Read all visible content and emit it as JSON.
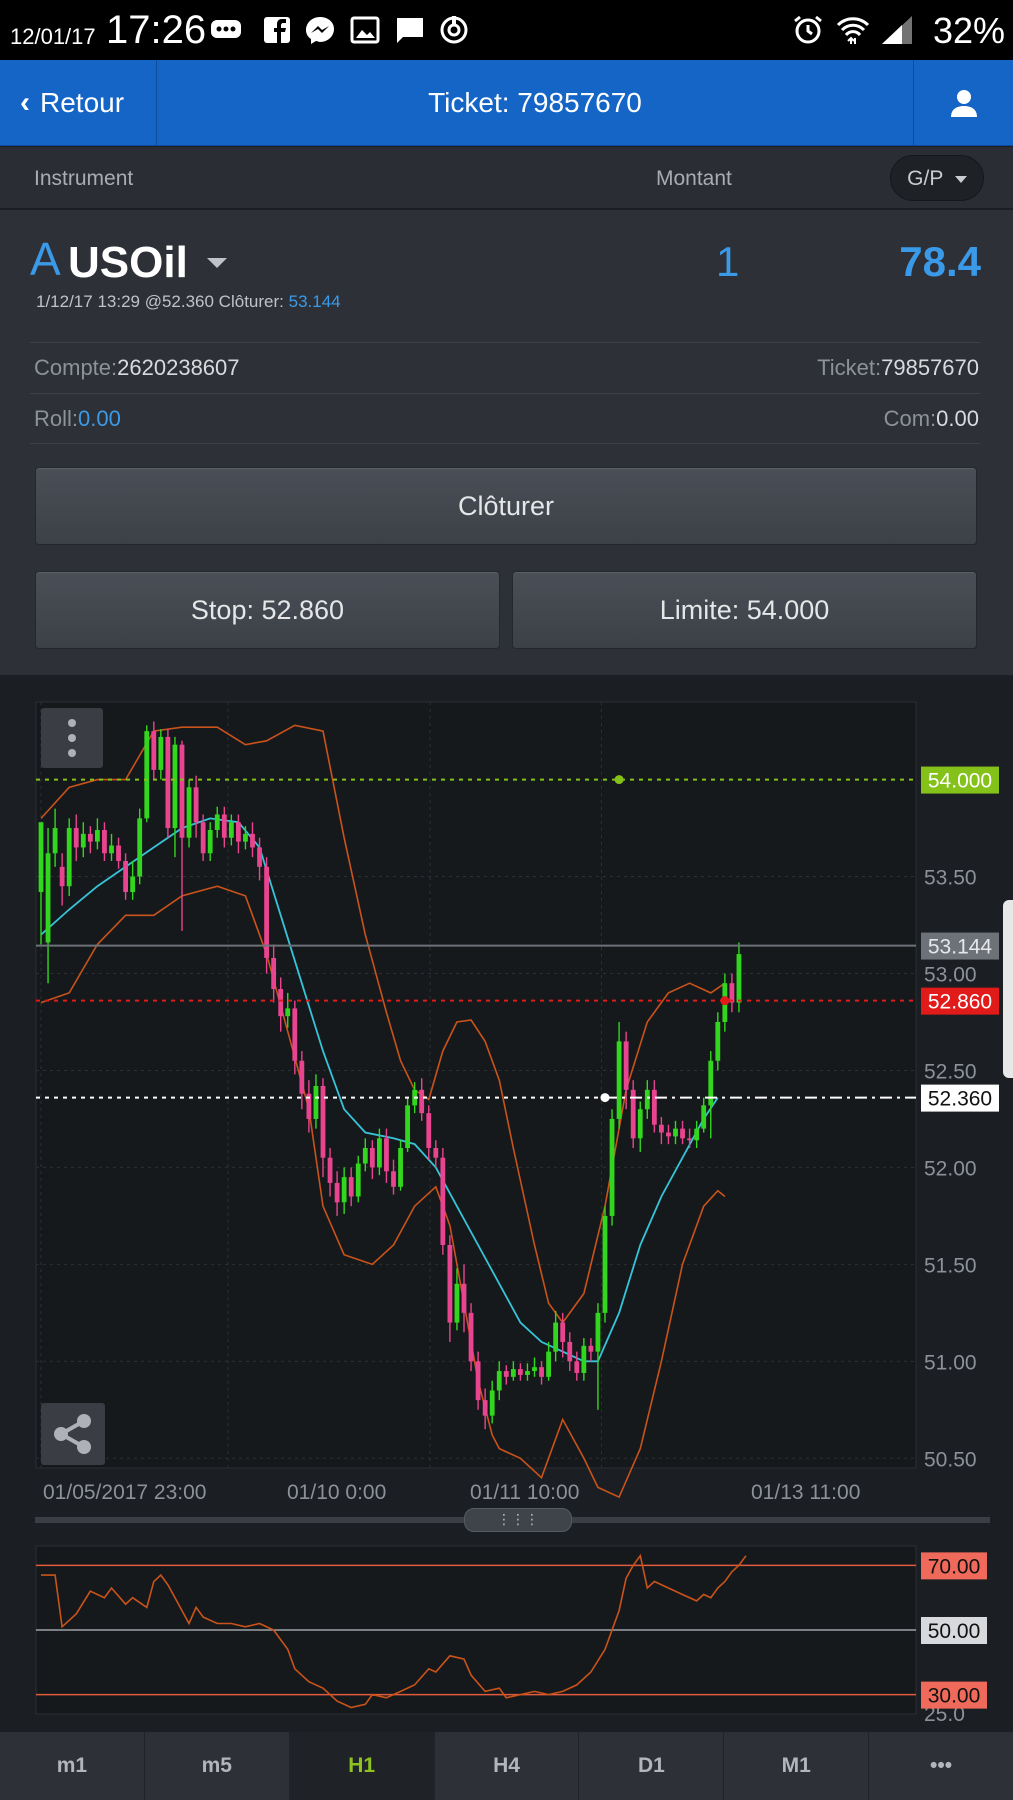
{
  "status_bar": {
    "date": "12/01/17",
    "time": "17:26",
    "battery": "32%",
    "icons": [
      "chat-bubble-icon",
      "facebook-icon",
      "messenger-icon",
      "gallery-icon",
      "message-icon",
      "sync-icon",
      "alarm-icon",
      "wifi-icon",
      "signal-icon"
    ]
  },
  "nav": {
    "back_label": "Retour",
    "title": "Ticket: 79857670"
  },
  "columns": {
    "instrument": "Instrument",
    "amount": "Montant",
    "gp_label": "G/P"
  },
  "position": {
    "prefix": "A",
    "symbol": "USOil",
    "quantity": "1",
    "pl": "78.4",
    "open_info": "1/12/17 13:29 @52.360 Clôturer:",
    "close_price": "53.144",
    "account_label": "Compte:",
    "account_value": "2620238607",
    "ticket_label": "Ticket:",
    "ticket_value": "79857670",
    "roll_label": "Roll:",
    "roll_value": "0.00",
    "com_label": "Com:",
    "com_value": "0.00"
  },
  "buttons": {
    "close": "Clôturer",
    "stop": "Stop: 52.860",
    "limit": "Limite: 54.000"
  },
  "timeframes": [
    "m1",
    "m5",
    "H1",
    "H4",
    "D1",
    "M1",
    "•••"
  ],
  "active_timeframe": "H1",
  "colors": {
    "accent_blue": "#3b9ae8",
    "nav_blue": "#1565c7",
    "bull": "#33d61e",
    "bear": "#e8448f",
    "limit": "#84c21a",
    "stop": "#e11a1a",
    "bollinger": "#c9531a",
    "ma": "#36c4d8",
    "rsi": "#c9531a"
  },
  "chart_data": [
    {
      "type": "candlestick",
      "x_tick_labels": [
        "01/05/2017 23:00",
        "01/10 0:00",
        "01/11 10:00",
        "01/13 11:00"
      ],
      "y_tick_labels": [
        "53.50",
        "53.00",
        "52.50",
        "52.00",
        "51.50",
        "51.00",
        "50.50"
      ],
      "ylim": [
        50.45,
        54.4
      ],
      "levels": [
        {
          "label": "54.000",
          "value": 54.0
        },
        {
          "label": "53.144",
          "value": 53.144
        },
        {
          "label": "52.860",
          "value": 52.86
        },
        {
          "label": "52.360",
          "value": 52.36
        }
      ],
      "candles": [
        [
          53.42,
          53.78,
          53.65,
          53.15
        ],
        [
          53.16,
          53.62,
          53.75,
          52.95
        ],
        [
          53.62,
          53.75,
          53.85,
          53.55
        ],
        [
          53.55,
          53.45,
          53.62,
          53.35
        ],
        [
          53.45,
          53.75,
          53.8,
          53.4
        ],
        [
          53.75,
          53.65,
          53.82,
          53.58
        ],
        [
          53.65,
          53.72,
          53.78,
          53.6
        ],
        [
          53.72,
          53.68,
          53.76,
          53.62
        ],
        [
          53.68,
          53.74,
          53.8,
          53.64
        ],
        [
          53.74,
          53.62,
          53.78,
          53.58
        ],
        [
          53.62,
          53.66,
          53.72,
          53.58
        ],
        [
          53.66,
          53.58,
          53.7,
          53.54
        ],
        [
          53.58,
          53.42,
          53.62,
          53.38
        ],
        [
          53.42,
          53.5,
          53.58,
          53.38
        ],
        [
          53.5,
          53.8,
          53.85,
          53.46
        ],
        [
          53.8,
          54.25,
          54.28,
          53.78
        ],
        [
          54.25,
          54.05,
          54.3,
          54.0
        ],
        [
          54.05,
          54.22,
          54.26,
          54.0
        ],
        [
          54.22,
          53.75,
          54.26,
          53.7
        ],
        [
          53.75,
          54.18,
          54.22,
          53.6
        ],
        [
          54.18,
          53.7,
          54.2,
          53.22
        ],
        [
          53.7,
          53.96,
          54.0,
          53.65
        ],
        [
          53.96,
          53.78,
          54.02,
          53.7
        ],
        [
          53.78,
          53.62,
          53.82,
          53.58
        ],
        [
          53.62,
          53.74,
          53.78,
          53.58
        ],
        [
          53.74,
          53.82,
          53.86,
          53.7
        ],
        [
          53.82,
          53.7,
          53.86,
          53.65
        ],
        [
          53.7,
          53.78,
          53.82,
          53.66
        ],
        [
          53.78,
          53.68,
          53.82,
          53.62
        ],
        [
          53.68,
          53.72,
          53.76,
          53.64
        ],
        [
          53.72,
          53.65,
          53.78,
          53.6
        ],
        [
          53.65,
          53.55,
          53.7,
          53.48
        ],
        [
          53.55,
          53.08,
          53.6,
          53.0
        ],
        [
          53.08,
          52.92,
          53.15,
          52.85
        ],
        [
          52.92,
          52.78,
          52.98,
          52.7
        ],
        [
          52.78,
          52.82,
          52.9,
          52.72
        ],
        [
          52.82,
          52.55,
          52.86,
          52.48
        ],
        [
          52.55,
          52.38,
          52.6,
          52.3
        ],
        [
          52.38,
          52.25,
          52.45,
          52.18
        ],
        [
          52.25,
          52.42,
          52.48,
          52.2
        ],
        [
          52.42,
          52.05,
          52.46,
          51.95
        ],
        [
          52.05,
          51.92,
          52.1,
          51.85
        ],
        [
          51.92,
          51.82,
          51.98,
          51.75
        ],
        [
          51.82,
          51.95,
          52.0,
          51.76
        ],
        [
          51.95,
          51.85,
          52.0,
          51.8
        ],
        [
          51.85,
          52.02,
          52.06,
          51.82
        ],
        [
          52.02,
          52.1,
          52.15,
          51.98
        ],
        [
          52.1,
          52.0,
          52.14,
          51.94
        ],
        [
          52.0,
          52.15,
          52.2,
          51.96
        ],
        [
          52.15,
          51.98,
          52.2,
          51.92
        ],
        [
          51.98,
          51.9,
          52.04,
          51.86
        ],
        [
          51.9,
          52.1,
          52.14,
          51.88
        ],
        [
          52.1,
          52.32,
          52.36,
          52.08
        ],
        [
          52.32,
          52.4,
          52.44,
          52.28
        ],
        [
          52.4,
          52.28,
          52.46,
          52.24
        ],
        [
          52.28,
          52.1,
          52.32,
          52.04
        ],
        [
          52.1,
          52.05,
          52.14,
          52.0
        ],
        [
          52.05,
          51.6,
          52.1,
          51.55
        ],
        [
          51.6,
          51.2,
          51.65,
          51.1
        ],
        [
          51.2,
          51.4,
          51.48,
          51.16
        ],
        [
          51.4,
          51.25,
          51.5,
          51.15
        ],
        [
          51.25,
          51.0,
          51.3,
          50.95
        ],
        [
          51.0,
          50.8,
          51.05,
          50.75
        ],
        [
          50.8,
          50.72,
          50.86,
          50.65
        ],
        [
          50.72,
          50.85,
          50.9,
          50.68
        ],
        [
          50.85,
          50.95,
          51.0,
          50.8
        ],
        [
          50.95,
          50.92,
          50.98,
          50.88
        ],
        [
          50.92,
          50.96,
          51.0,
          50.9
        ],
        [
          50.96,
          50.93,
          50.99,
          50.9
        ],
        [
          50.93,
          50.95,
          50.99,
          50.9
        ],
        [
          50.95,
          50.97,
          51.02,
          50.92
        ],
        [
          50.97,
          50.92,
          51.0,
          50.88
        ],
        [
          50.92,
          51.05,
          51.1,
          50.9
        ],
        [
          51.05,
          51.2,
          51.26,
          51.0
        ],
        [
          51.2,
          51.1,
          51.25,
          51.02
        ],
        [
          51.1,
          51.0,
          51.15,
          50.95
        ],
        [
          51.0,
          50.94,
          51.05,
          50.9
        ],
        [
          50.94,
          51.08,
          51.12,
          50.9
        ],
        [
          51.08,
          51.05,
          51.12,
          51.0
        ],
        [
          51.05,
          51.25,
          51.3,
          50.75
        ],
        [
          51.25,
          51.75,
          51.8,
          51.2
        ],
        [
          51.75,
          52.25,
          52.3,
          51.7
        ],
        [
          52.25,
          52.65,
          52.75,
          52.2
        ],
        [
          52.65,
          52.4,
          52.7,
          52.3
        ],
        [
          52.4,
          52.15,
          52.45,
          52.1
        ],
        [
          52.15,
          52.3,
          52.34,
          52.08
        ],
        [
          52.3,
          52.4,
          52.45,
          52.25
        ],
        [
          52.4,
          52.22,
          52.45,
          52.18
        ],
        [
          52.22,
          52.18,
          52.26,
          52.12
        ],
        [
          52.18,
          52.16,
          52.22,
          52.12
        ],
        [
          52.16,
          52.2,
          52.24,
          52.12
        ],
        [
          52.2,
          52.15,
          52.24,
          52.12
        ],
        [
          52.15,
          52.14,
          52.2,
          52.1
        ],
        [
          52.14,
          52.2,
          52.24,
          52.1
        ],
        [
          52.2,
          52.32,
          52.36,
          52.18
        ],
        [
          52.32,
          52.55,
          52.6,
          52.15
        ],
        [
          52.55,
          52.75,
          52.8,
          52.5
        ],
        [
          52.75,
          52.95,
          53.0,
          52.7
        ],
        [
          52.95,
          52.85,
          53.0,
          52.8
        ],
        [
          52.85,
          53.1,
          53.16,
          52.8
        ]
      ],
      "moving_average": [
        [
          0,
          53.2
        ],
        [
          4,
          53.33
        ],
        [
          8,
          53.45
        ],
        [
          12,
          53.55
        ],
        [
          16,
          53.65
        ],
        [
          20,
          53.75
        ],
        [
          24,
          53.8
        ],
        [
          28,
          53.78
        ],
        [
          31,
          53.65
        ],
        [
          34,
          53.3
        ],
        [
          37,
          52.95
        ],
        [
          40,
          52.6
        ],
        [
          43,
          52.3
        ],
        [
          46,
          52.18
        ],
        [
          50,
          52.15
        ],
        [
          53,
          52.12
        ],
        [
          56,
          52.0
        ],
        [
          59,
          51.8
        ],
        [
          62,
          51.6
        ],
        [
          65,
          51.4
        ],
        [
          68,
          51.2
        ],
        [
          71,
          51.1
        ],
        [
          74,
          51.05
        ],
        [
          77,
          51.0
        ],
        [
          79,
          51.0
        ],
        [
          82,
          51.25
        ],
        [
          85,
          51.6
        ],
        [
          88,
          51.85
        ],
        [
          91,
          52.05
        ],
        [
          94,
          52.25
        ],
        [
          96,
          52.36
        ]
      ],
      "bollinger_upper": [
        [
          0,
          53.8
        ],
        [
          4,
          53.96
        ],
        [
          8,
          54.0
        ],
        [
          12,
          54.0
        ],
        [
          16,
          54.25
        ],
        [
          20,
          54.27
        ],
        [
          25,
          54.27
        ],
        [
          29,
          54.18
        ],
        [
          32,
          54.2
        ],
        [
          36,
          54.28
        ],
        [
          40,
          54.25
        ],
        [
          43,
          53.7
        ],
        [
          46,
          53.2
        ],
        [
          49,
          52.8
        ],
        [
          51,
          52.55
        ],
        [
          53,
          52.4
        ],
        [
          55,
          52.35
        ],
        [
          57,
          52.6
        ],
        [
          59,
          52.75
        ],
        [
          61,
          52.76
        ],
        [
          63,
          52.65
        ],
        [
          65,
          52.45
        ],
        [
          67,
          52.1
        ],
        [
          70,
          51.6
        ],
        [
          72,
          51.3
        ],
        [
          74,
          51.2
        ],
        [
          77,
          51.35
        ],
        [
          80,
          51.8
        ],
        [
          83,
          52.4
        ],
        [
          86,
          52.75
        ],
        [
          89,
          52.9
        ],
        [
          92,
          52.95
        ],
        [
          95,
          52.9
        ],
        [
          97,
          52.95
        ]
      ],
      "bollinger_lower": [
        [
          0,
          52.85
        ],
        [
          4,
          52.9
        ],
        [
          8,
          53.15
        ],
        [
          12,
          53.3
        ],
        [
          16,
          53.3
        ],
        [
          20,
          53.4
        ],
        [
          25,
          53.45
        ],
        [
          29,
          53.4
        ],
        [
          32,
          53.1
        ],
        [
          35,
          52.7
        ],
        [
          38,
          52.3
        ],
        [
          40,
          51.8
        ],
        [
          43,
          51.55
        ],
        [
          47,
          51.5
        ],
        [
          50,
          51.6
        ],
        [
          53,
          51.8
        ],
        [
          56,
          51.9
        ],
        [
          58,
          51.7
        ],
        [
          60,
          51.3
        ],
        [
          62,
          50.9
        ],
        [
          64,
          50.62
        ],
        [
          65,
          50.55
        ],
        [
          68,
          50.5
        ],
        [
          71,
          50.4
        ],
        [
          74,
          50.7
        ],
        [
          77,
          50.5
        ],
        [
          79,
          50.35
        ],
        [
          82,
          50.3
        ],
        [
          85,
          50.55
        ],
        [
          88,
          51.0
        ],
        [
          91,
          51.5
        ],
        [
          94,
          51.8
        ],
        [
          96,
          51.88
        ],
        [
          97,
          51.85
        ]
      ]
    },
    {
      "type": "line",
      "ylim": [
        24,
        76
      ],
      "y_tick_labels": [
        "70.00",
        "50.00",
        "30.00"
      ],
      "partial_tick_label": "25.0",
      "levels": [
        70,
        50,
        30
      ],
      "rsi": [
        [
          0,
          67
        ],
        [
          2,
          67
        ],
        [
          3,
          51
        ],
        [
          5,
          55
        ],
        [
          7,
          62
        ],
        [
          9,
          60
        ],
        [
          10,
          63
        ],
        [
          12,
          58
        ],
        [
          13,
          60
        ],
        [
          15,
          57
        ],
        [
          16,
          65
        ],
        [
          17,
          67
        ],
        [
          18,
          64
        ],
        [
          20,
          56
        ],
        [
          21,
          52
        ],
        [
          22,
          57
        ],
        [
          23,
          54
        ],
        [
          25,
          52
        ],
        [
          27,
          52
        ],
        [
          29,
          51
        ],
        [
          31,
          52
        ],
        [
          33,
          50
        ],
        [
          35,
          44
        ],
        [
          36,
          38
        ],
        [
          38,
          34
        ],
        [
          40,
          32
        ],
        [
          42,
          28
        ],
        [
          44,
          26
        ],
        [
          46,
          27
        ],
        [
          47,
          30
        ],
        [
          49,
          29
        ],
        [
          51,
          31
        ],
        [
          53,
          33
        ],
        [
          55,
          38
        ],
        [
          56,
          37
        ],
        [
          58,
          42
        ],
        [
          60,
          41
        ],
        [
          61,
          36
        ],
        [
          63,
          31
        ],
        [
          65,
          32
        ],
        [
          66,
          29
        ],
        [
          68,
          30
        ],
        [
          70,
          31
        ],
        [
          72,
          30
        ],
        [
          74,
          31
        ],
        [
          76,
          33
        ],
        [
          78,
          37
        ],
        [
          80,
          44
        ],
        [
          82,
          56
        ],
        [
          83,
          66
        ],
        [
          84,
          70
        ],
        [
          85,
          73
        ],
        [
          86,
          63
        ],
        [
          87,
          65
        ],
        [
          89,
          63
        ],
        [
          91,
          61
        ],
        [
          93,
          59
        ],
        [
          94,
          61
        ],
        [
          95,
          60
        ],
        [
          96,
          63
        ],
        [
          97,
          65
        ],
        [
          98,
          68
        ],
        [
          99,
          70
        ],
        [
          100,
          73
        ]
      ]
    }
  ]
}
